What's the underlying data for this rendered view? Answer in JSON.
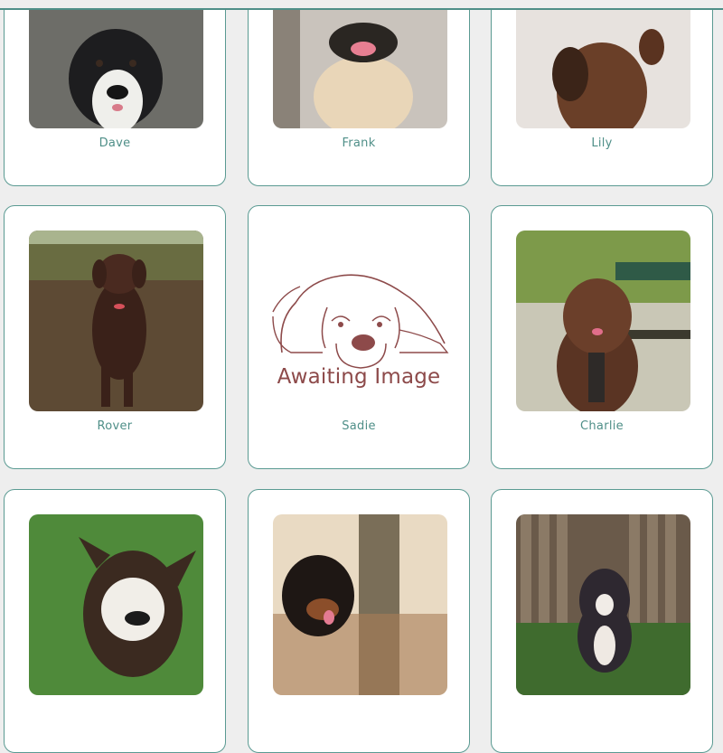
{
  "dogs": [
    {
      "name": "Dave",
      "photo": "border-collie-photo"
    },
    {
      "name": "Frank",
      "photo": "pug-photo"
    },
    {
      "name": "Lily",
      "photo": "spaniel-photo"
    },
    {
      "name": "Rover",
      "photo": "chocolate-labrador-photo"
    },
    {
      "name": "Sadie",
      "photo": "placeholder-basset-hound-illustration",
      "placeholder_text": "Awaiting Image"
    },
    {
      "name": "Charlie",
      "photo": "poodle-photo"
    },
    {
      "name": "",
      "photo": "french-bulldog-photo"
    },
    {
      "name": "",
      "photo": "rottweiler-photo"
    },
    {
      "name": "",
      "photo": "pit-bull-photo"
    }
  ],
  "colors": {
    "accent": "#4f8f88",
    "placeholder": "#8d4a4a",
    "background": "#eeeeee"
  }
}
